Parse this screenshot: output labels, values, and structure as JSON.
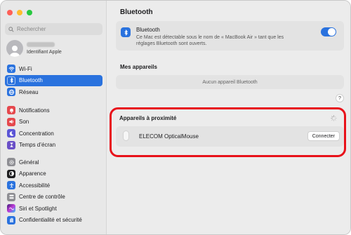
{
  "window": {
    "controls": [
      "close",
      "minimize",
      "zoom"
    ]
  },
  "sidebar": {
    "search_placeholder": "Rechercher",
    "account": {
      "subtitle": "Identifiant Apple"
    },
    "groups": [
      {
        "items": [
          {
            "label": "Wi-Fi",
            "icon": "wifi-icon",
            "color": "#2a72de",
            "active": false
          },
          {
            "label": "Bluetooth",
            "icon": "bluetooth-icon",
            "color": "#2a72de",
            "active": true
          },
          {
            "label": "Réseau",
            "icon": "globe-icon",
            "color": "#2a72de",
            "active": false
          }
        ]
      },
      {
        "items": [
          {
            "label": "Notifications",
            "icon": "bell-icon",
            "color": "#e5484d"
          },
          {
            "label": "Son",
            "icon": "speaker-icon",
            "color": "#e5484d"
          },
          {
            "label": "Concentration",
            "icon": "moon-icon",
            "color": "#5b55d6"
          },
          {
            "label": "Temps d’écran",
            "icon": "hourglass-icon",
            "color": "#6a4fc7"
          }
        ]
      },
      {
        "items": [
          {
            "label": "Général",
            "icon": "gear-icon",
            "color": "#8e8e93"
          },
          {
            "label": "Apparence",
            "icon": "appearance-icon",
            "color": "#1d1d1f"
          },
          {
            "label": "Accessibilité",
            "icon": "accessibility-icon",
            "color": "#2a72de"
          },
          {
            "label": "Centre de contrôle",
            "icon": "control-center-icon",
            "color": "#8e8e93"
          },
          {
            "label": "Siri et Spotlight",
            "icon": "siri-icon",
            "color": "#c03ad6"
          },
          {
            "label": "Confidentialité et sécurité",
            "icon": "hand-icon",
            "color": "#2a72de"
          }
        ]
      }
    ]
  },
  "main": {
    "title": "Bluetooth",
    "bluetooth": {
      "name": "Bluetooth",
      "description": "Ce Mac est détectable sous le nom de « MacBook Air » tant que les réglages Bluetooth sont ouverts.",
      "enabled": true
    },
    "my_devices": {
      "title": "Mes appareils",
      "empty_text": "Aucun appareil Bluetooth"
    },
    "help_label": "?",
    "nearby": {
      "title": "Appareils à proximité",
      "devices": [
        {
          "name": "ELECOM OpticalMouse",
          "action": "Connecter"
        }
      ]
    },
    "highlight_color": "#e8111a",
    "accent_color": "#2a72de"
  }
}
